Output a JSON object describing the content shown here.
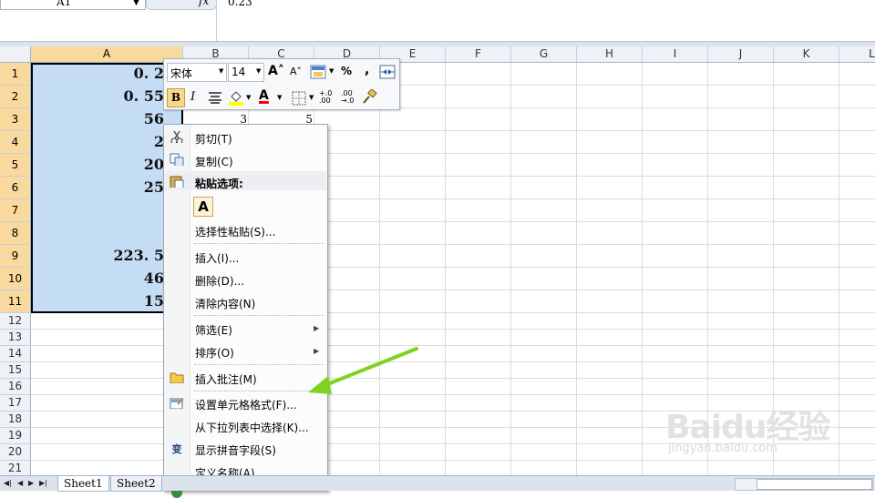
{
  "formula_bar": {
    "name_box": "A1",
    "fx": "fx",
    "value": "0.23"
  },
  "columns": [
    "A",
    "B",
    "C",
    "D",
    "E",
    "F",
    "G",
    "H",
    "I",
    "J",
    "K",
    "L"
  ],
  "rows": [
    "1",
    "2",
    "3",
    "4",
    "5",
    "6",
    "7",
    "8",
    "9",
    "10",
    "11",
    "12",
    "13",
    "14",
    "15",
    "16",
    "17",
    "18",
    "19",
    "20",
    "21"
  ],
  "cells_a": [
    "0. 2",
    "0. 55",
    "56",
    "2",
    "20",
    "25",
    "",
    "",
    "223. 5",
    "46",
    "15"
  ],
  "cells_row3": {
    "b": "3",
    "c": "5"
  },
  "mini_toolbar": {
    "font_name": "宋体",
    "font_size": "14",
    "bold": "B",
    "italic": "I",
    "percent": "%",
    "comma": ",",
    "grow_font": "A˄",
    "shrink_font": "A˅",
    "font_color_letter": "A",
    "inc_decimal": "+.0 .00",
    "dec_decimal": ".00 →.0",
    "colors": {
      "highlight": "#ffff00",
      "font": "#ff0000"
    }
  },
  "context_menu": {
    "cut": "剪切(T)",
    "copy": "复制(C)",
    "paste_options": "粘贴选项:",
    "paste_a": "A",
    "paste_special": "选择性粘贴(S)...",
    "insert": "插入(I)...",
    "delete": "删除(D)...",
    "clear": "清除内容(N)",
    "filter": "筛选(E)",
    "sort": "排序(O)",
    "insert_comment": "插入批注(M)",
    "format_cells": "设置单元格格式(F)...",
    "pick_from_list": "从下拉列表中选择(K)...",
    "show_pinyin": "显示拼音字段(S)",
    "define_name": "定义名称(A)..."
  },
  "sheet_tabs": [
    "Sheet1",
    "Sheet2"
  ],
  "watermark": {
    "title": "Baidu经验",
    "subtitle": "jingyan.baidu.com"
  },
  "annotation": {
    "arrow_color": "#7ed321"
  }
}
